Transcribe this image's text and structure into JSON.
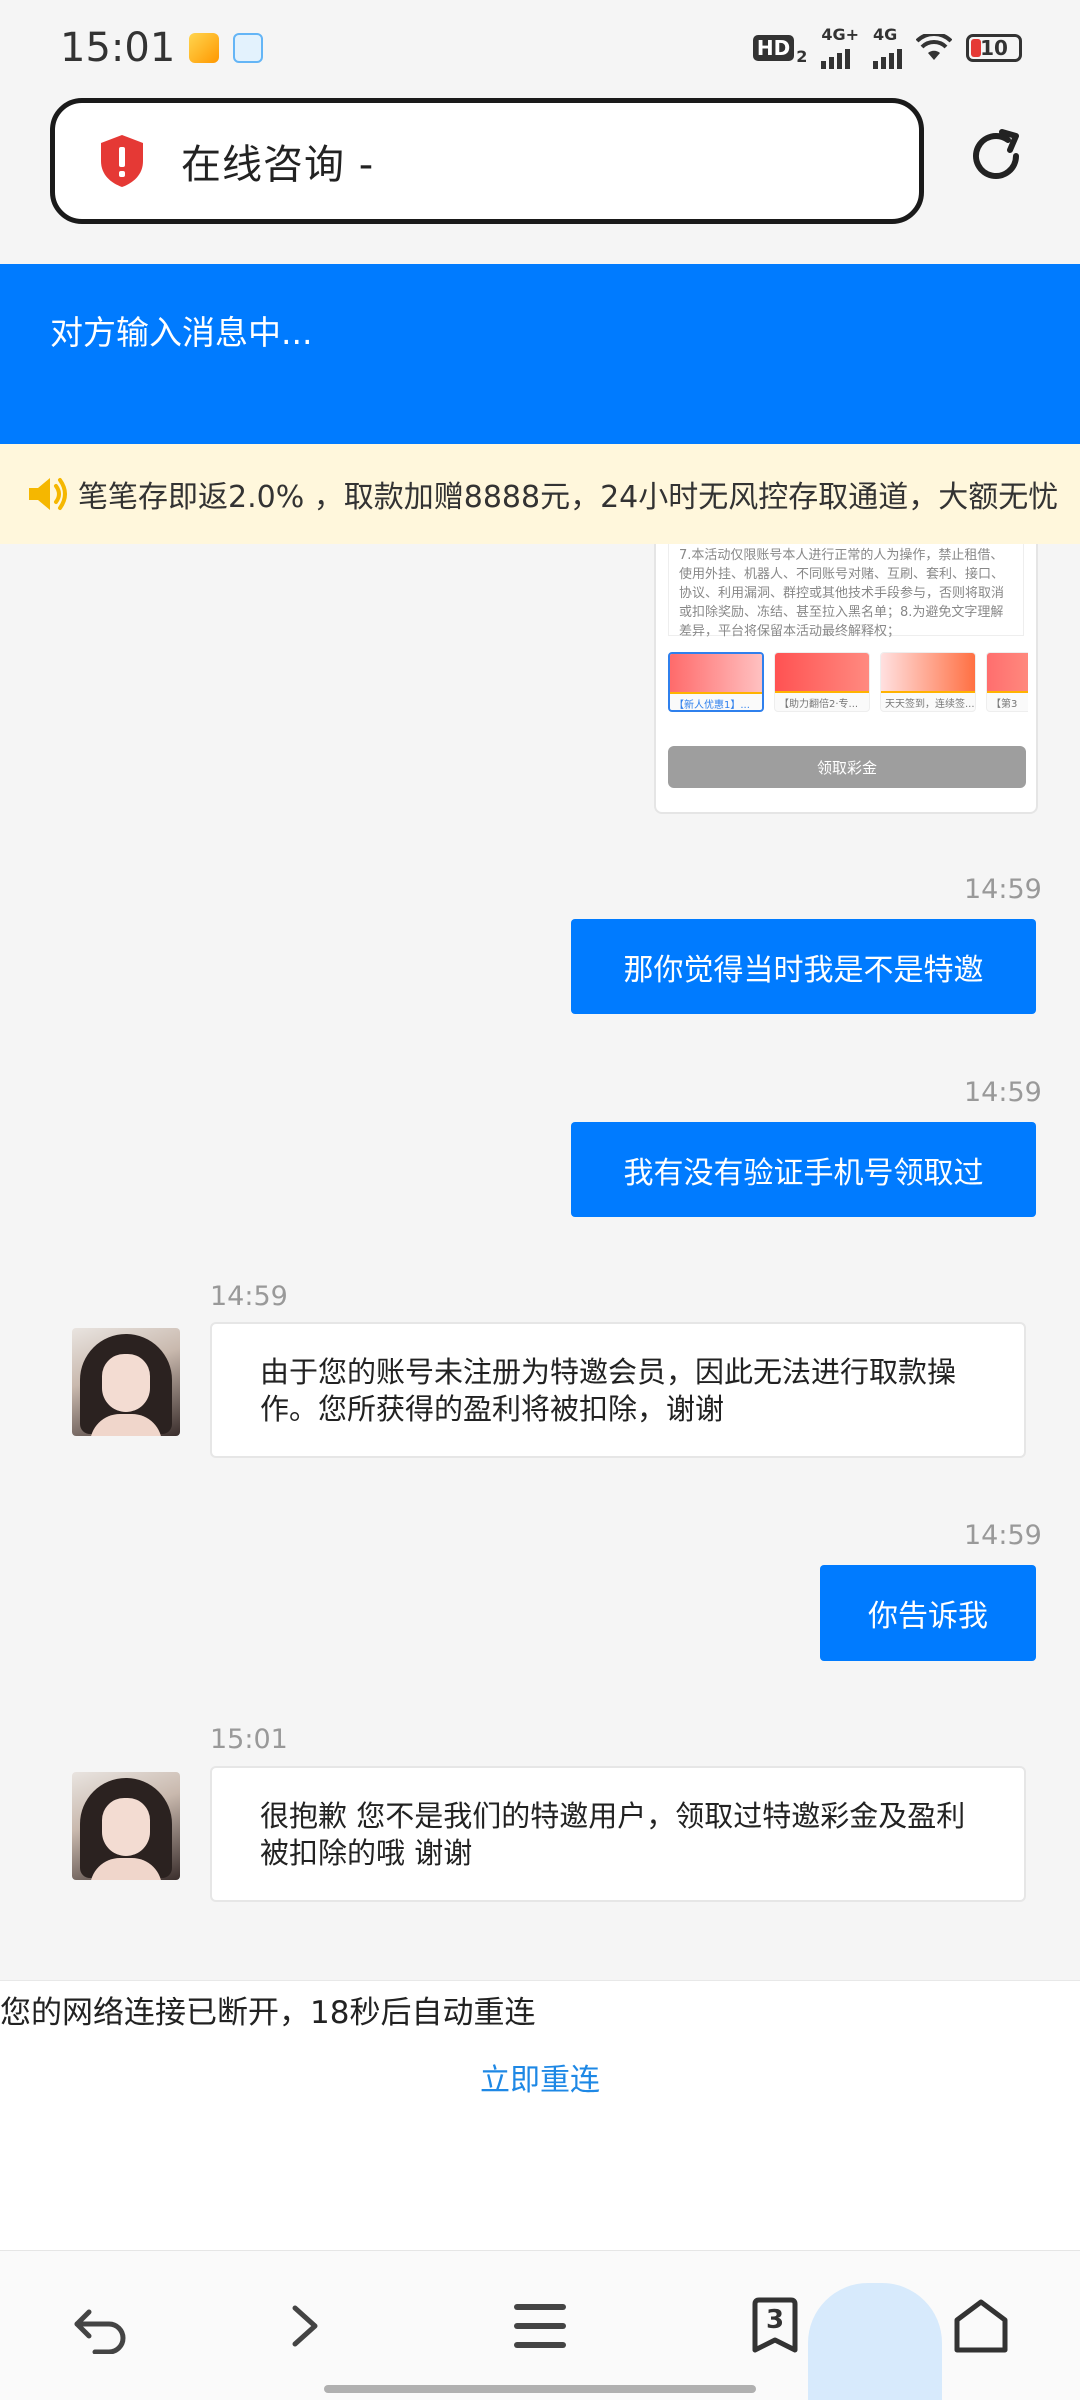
{
  "status_bar": {
    "time": "15:01",
    "hd_label": "HD",
    "hd_sub": "2",
    "net1": "4G+",
    "net2": "4G",
    "battery": "10"
  },
  "address_bar": {
    "title": "在线咨询 -",
    "icon": "shield-warning-icon"
  },
  "chat_header": {
    "typing_text": "对方输入消息中..."
  },
  "announcement": {
    "icon": "speaker-icon",
    "text": "笔笔存即返2.0% ，取款加赠8888元，24小时无风控存取通道，大额无忧"
  },
  "promo_card": {
    "rules_text": "7.本活动仅限账号本人进行正常的人为操作，禁止租借、使用外挂、机器人、不同账号对赌、互刷、套利、接口、协议、利用漏洞、群控或其他技术手段参与，否则将取消或扣除奖励、冻结、甚至拉入黑名单；8.为避免文字理解差异，平台将保留本活动最终解释权；",
    "thumbs": [
      "【新人优惠1】...",
      "【助力翻倍2·专...",
      "天天签到，连续签...",
      "【第3"
    ],
    "button_label": "领取彩金"
  },
  "messages": [
    {
      "from": "me",
      "time": "14:59",
      "text": "那你觉得当时我是不是特邀"
    },
    {
      "from": "me",
      "time": "14:59",
      "text": "我有没有验证手机号领取过"
    },
    {
      "from": "agent",
      "time": "14:59",
      "text": "由于您的账号未注册为特邀会员，因此无法进行取款操作。您所获得的盈利将被扣除，谢谢"
    },
    {
      "from": "me",
      "time": "14:59",
      "text": "你告诉我"
    },
    {
      "from": "agent",
      "time": "15:01",
      "text": "很抱歉 您不是我们的特邀用户，领取过特邀彩金及盈利被扣除的哦 谢谢"
    }
  ],
  "network": {
    "message": "您的网络连接已断开，18秒后自动重连",
    "reconnect_label": "立即重连"
  },
  "bottom_nav": {
    "tab_count": "3"
  },
  "colors": {
    "accent": "#007bff",
    "announce_bg": "#fff7dc",
    "link": "#1e88e5"
  }
}
